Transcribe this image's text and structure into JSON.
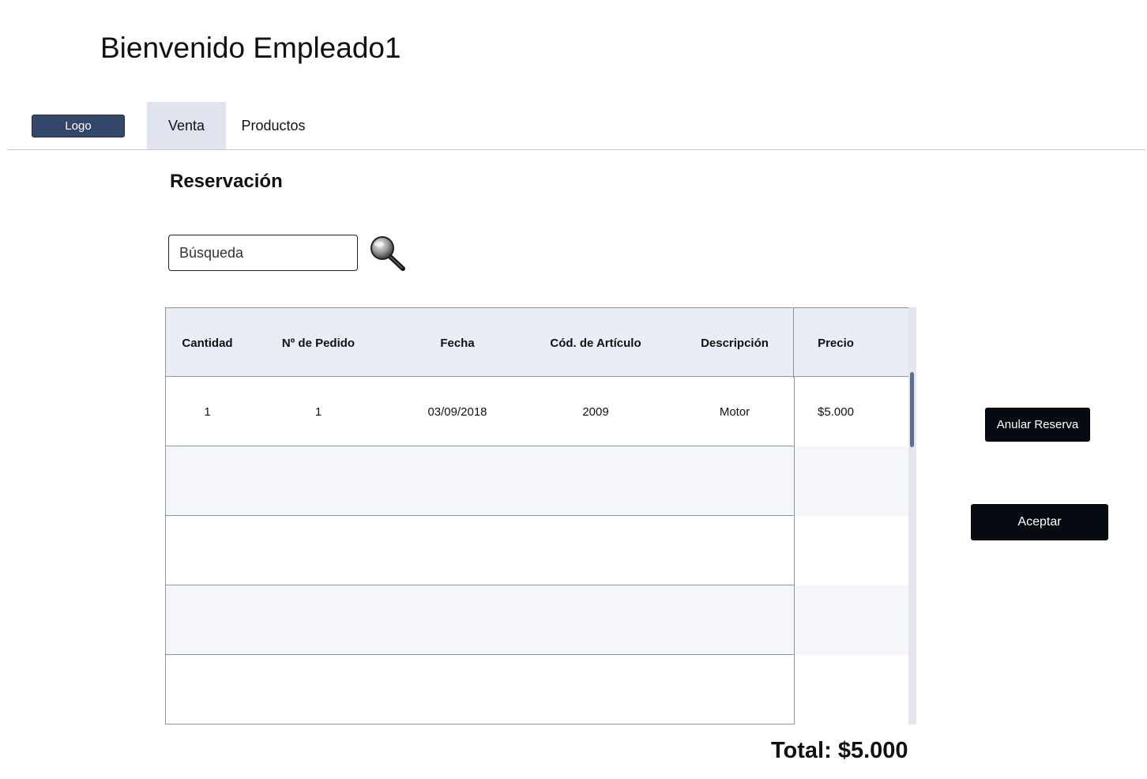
{
  "header": {
    "welcome": "Bienvenido Empleado1"
  },
  "nav": {
    "logo_label": "Logo",
    "tabs": [
      {
        "label": "Venta",
        "active": true
      },
      {
        "label": "Productos",
        "active": false
      }
    ]
  },
  "main": {
    "section_title": "Reservación",
    "search": {
      "placeholder": "Búsqueda",
      "value": ""
    },
    "table": {
      "columns": [
        "Cantidad",
        "Nº de Pedido",
        "Fecha",
        "Cód. de Artículo",
        "Descripción",
        "Precio"
      ],
      "rows": [
        [
          "1",
          "1",
          "03/09/2018",
          "2009",
          "Motor",
          "$5.000"
        ],
        [
          "",
          "",
          "",
          "",
          "",
          ""
        ],
        [
          "",
          "",
          "",
          "",
          "",
          ""
        ],
        [
          "",
          "",
          "",
          "",
          "",
          ""
        ],
        [
          "",
          "",
          "",
          "",
          "",
          ""
        ]
      ]
    },
    "total": "Total: $5.000"
  },
  "actions": {
    "cancel_reservation": "Anular Reserva",
    "accept": "Aceptar"
  },
  "colors": {
    "logo_bg": "#34476b",
    "active_tab_bg": "#dfe4ef",
    "header_row_bg": "#e9edf5",
    "dark_button_bg": "#060b12"
  }
}
